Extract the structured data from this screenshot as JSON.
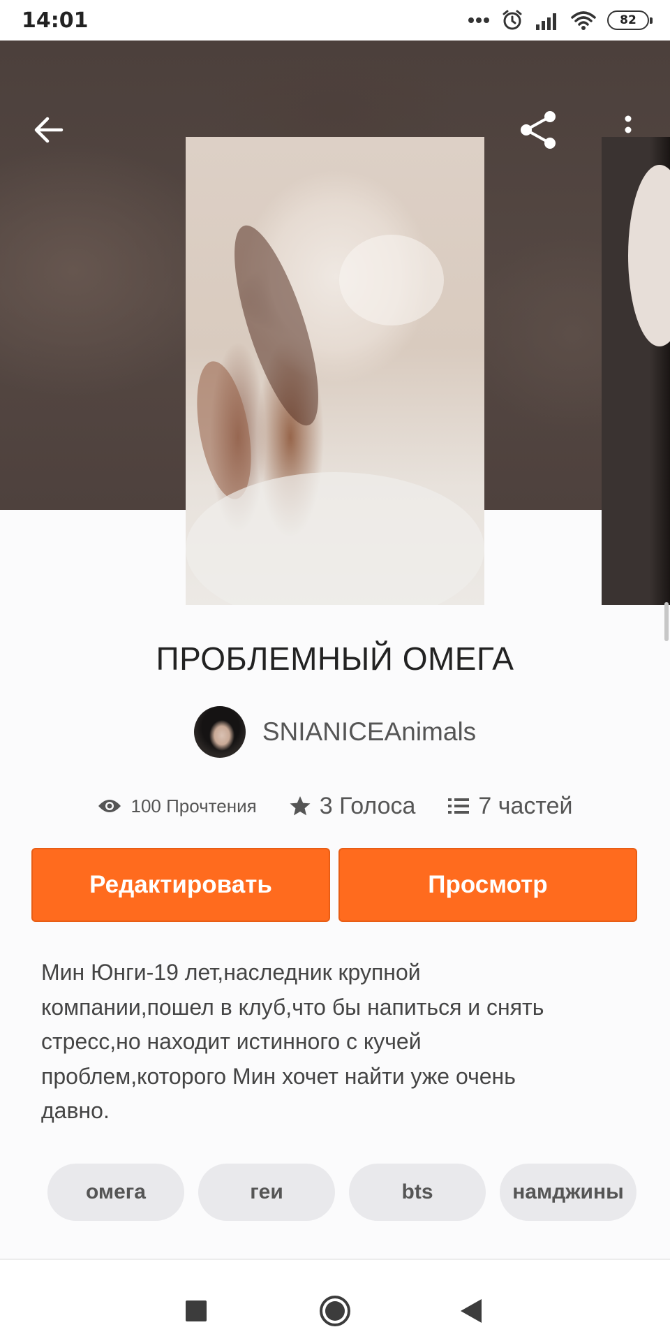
{
  "status_bar": {
    "time": "14:01",
    "battery": "82",
    "icons": [
      "dots-icon",
      "alarm-icon",
      "signal-icon",
      "wifi-icon",
      "battery-icon"
    ]
  },
  "header": {
    "icons": [
      "back-arrow-icon",
      "share-icon",
      "more-vertical-icon"
    ],
    "background_color": "#554843"
  },
  "story": {
    "title": "ПРОБЛЕМНЫЙ ОМЕГА",
    "author": "SNIANICEAnimals",
    "stats": {
      "reads": "100 Прочтения",
      "votes": "3 Голоса",
      "parts": "7 частей"
    },
    "description": "Мин Юнги-19 лет,наследник крупной компании,пошел в клуб,что бы напиться и снять стресс,но находит истинного с кучей проблем,которого Мин хочет найти уже очень давно.",
    "tags": [
      "омега",
      "геи",
      "bts",
      "намджины"
    ]
  },
  "actions": {
    "edit_label": "Редактировать",
    "view_label": "Просмотр"
  },
  "colors": {
    "accent": "#ff6b1e",
    "tag_bg": "#e9e9ec",
    "text_muted": "#555555"
  },
  "nav_bar": {
    "icons": [
      "recent-apps-icon",
      "home-icon",
      "back-icon"
    ]
  }
}
